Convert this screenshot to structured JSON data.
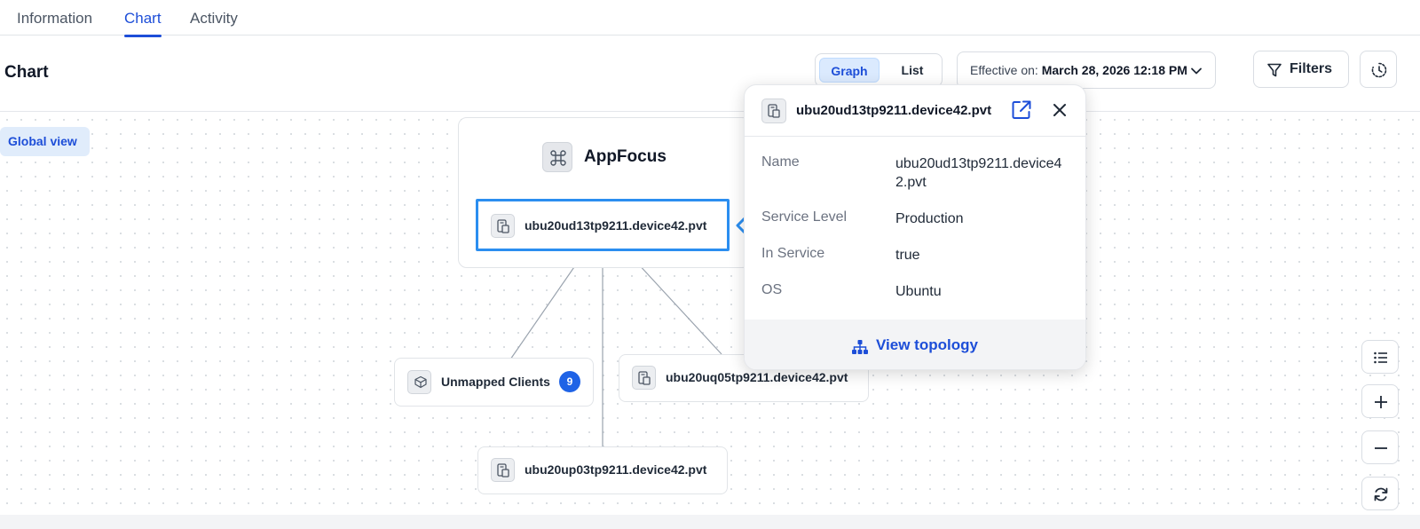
{
  "tabs": [
    {
      "label": "Information",
      "active": false
    },
    {
      "label": "Chart",
      "active": true
    },
    {
      "label": "Activity",
      "active": false
    }
  ],
  "header": {
    "title": "Chart",
    "view_toggle": {
      "graph": "Graph",
      "list": "List",
      "selected": "Graph"
    },
    "effective_label": "Effective on:",
    "effective_value": "March 28, 2026 12:18 PM",
    "filters_label": "Filters"
  },
  "canvas": {
    "global_view_label": "Global view",
    "group": {
      "title": "AppFocus",
      "icon": "command-icon"
    },
    "nodes": {
      "selected": "ubu20ud13tp9211.device42.pvt",
      "unmapped": "Unmapped Clients",
      "unmapped_count": "9",
      "uq05": "ubu20uq05tp9211.device42.pvt",
      "up03": "ubu20up03tp9211.device42.pvt"
    }
  },
  "popover": {
    "title": "ubu20ud13tp9211.device42.pvt",
    "rows": [
      {
        "key": "Name",
        "value": "ubu20ud13tp9211.device42.pvt"
      },
      {
        "key": "Service Level",
        "value": "Production"
      },
      {
        "key": "In Service",
        "value": "true"
      },
      {
        "key": "OS",
        "value": "Ubuntu"
      }
    ],
    "footer_link": "View topology"
  },
  "colors": {
    "accent": "#1d4ed8",
    "selected_border": "#2b8ef0",
    "badge": "#1f63e6"
  }
}
